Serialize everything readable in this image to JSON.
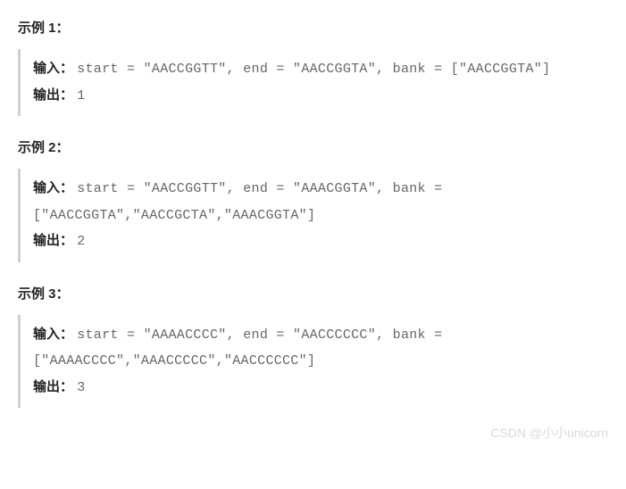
{
  "examples": [
    {
      "heading": "示例 1：",
      "input_label": "输入：",
      "input_code": "start = \"AACCGGTT\", end = \"AACCGGTA\", bank = [\"AACCGGTA\"]",
      "output_label": "输出：",
      "output_code": "1"
    },
    {
      "heading": "示例 2：",
      "input_label": "输入：",
      "input_code": "start = \"AACCGGTT\", end = \"AAACGGTA\", bank = [\"AACCGGTA\",\"AACCGCTA\",\"AAACGGTA\"]",
      "output_label": "输出：",
      "output_code": "2"
    },
    {
      "heading": "示例 3：",
      "input_label": "输入：",
      "input_code": "start = \"AAAACCCC\", end = \"AACCCCCC\", bank = [\"AAAACCCC\",\"AAACCCCC\",\"AACCCCCC\"]",
      "output_label": "输出：",
      "output_code": "3"
    }
  ],
  "watermark": "CSDN @小小unicorn"
}
